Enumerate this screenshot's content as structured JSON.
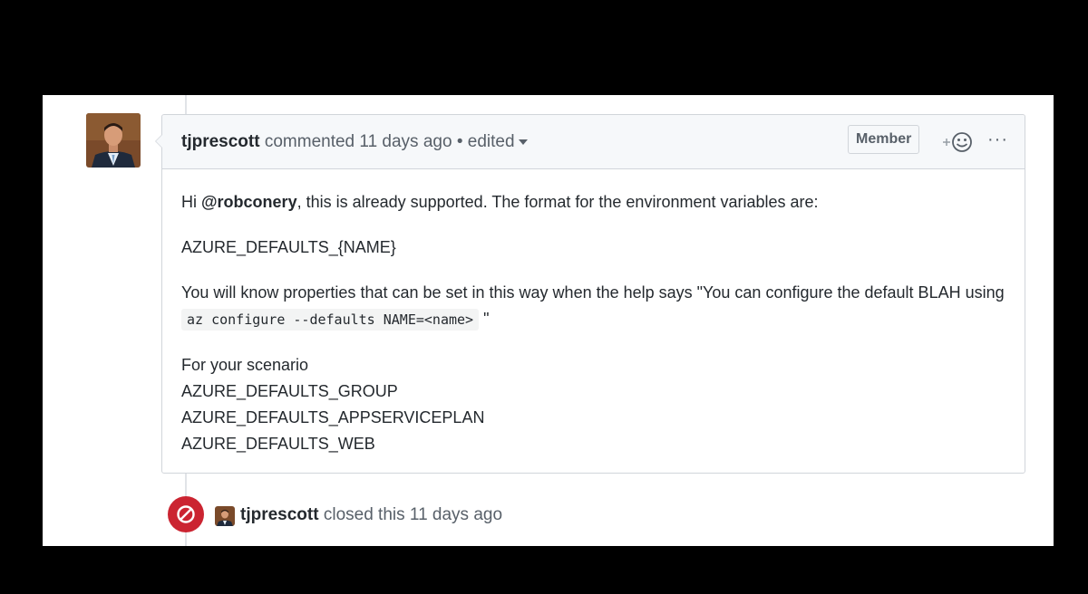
{
  "comment": {
    "author": "tjprescott",
    "action": "commented",
    "time": "11 days ago",
    "separator": "•",
    "edited_label": "edited",
    "badge": "Member",
    "more_label": "···",
    "body": {
      "p1_prefix": "Hi ",
      "p1_mention": "@robconery",
      "p1_suffix": ", this is already supported. The format for the environment variables are:",
      "p2": "AZURE_DEFAULTS_{NAME}",
      "p3_prefix": "You will know properties that can be set in this way when the help says \"You can configure the default BLAH using ",
      "p3_code": "az configure --defaults NAME=<name>",
      "p3_suffix": " \"",
      "p4_lines": [
        "For your scenario",
        "AZURE_DEFAULTS_GROUP",
        "AZURE_DEFAULTS_APPSERVICEPLAN",
        "AZURE_DEFAULTS_WEB"
      ]
    }
  },
  "event": {
    "author": "tjprescott",
    "text": "closed this 11 days ago",
    "badge_icon": "circle-slash-icon",
    "badge_color": "#cb2431"
  }
}
